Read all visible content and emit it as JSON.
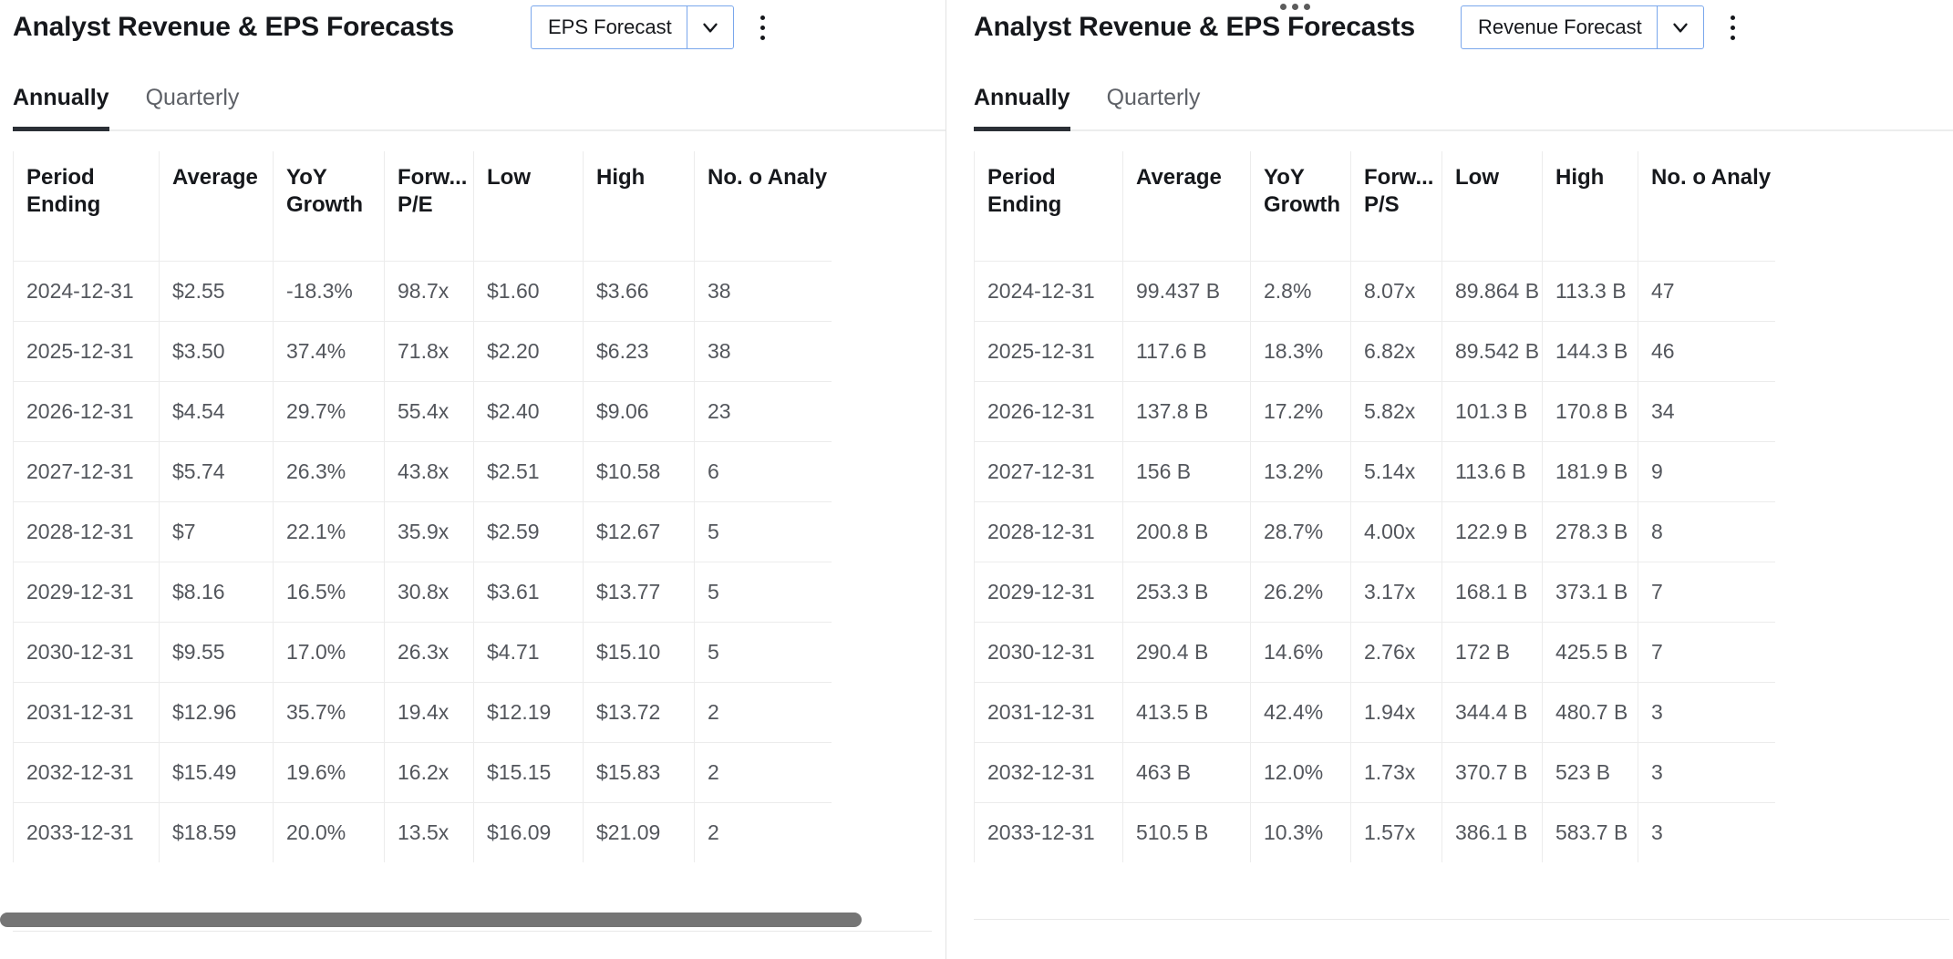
{
  "panels": [
    {
      "id": "eps-panel",
      "title": "Analyst Revenue & EPS Forecasts",
      "select": {
        "value": "EPS Forecast",
        "caret_icon": "chevron-down-icon",
        "border_color": "#7aa7ec"
      },
      "kebab_icon": "kebab-menu-icon",
      "tabs": [
        {
          "label": "Annually",
          "active": true
        },
        {
          "label": "Quarterly",
          "active": false
        }
      ],
      "table": {
        "columns": [
          "Period Ending",
          "Average",
          "YoY Growth",
          "Forw... P/E",
          "Low",
          "High",
          "No. o Analy"
        ],
        "rows": [
          [
            "2024-12-31",
            "$2.55",
            "-18.3%",
            "98.7x",
            "$1.60",
            "$3.66",
            "38"
          ],
          [
            "2025-12-31",
            "$3.50",
            "37.4%",
            "71.8x",
            "$2.20",
            "$6.23",
            "38"
          ],
          [
            "2026-12-31",
            "$4.54",
            "29.7%",
            "55.4x",
            "$2.40",
            "$9.06",
            "23"
          ],
          [
            "2027-12-31",
            "$5.74",
            "26.3%",
            "43.8x",
            "$2.51",
            "$10.58",
            "6"
          ],
          [
            "2028-12-31",
            "$7",
            "22.1%",
            "35.9x",
            "$2.59",
            "$12.67",
            "5"
          ],
          [
            "2029-12-31",
            "$8.16",
            "16.5%",
            "30.8x",
            "$3.61",
            "$13.77",
            "5"
          ],
          [
            "2030-12-31",
            "$9.55",
            "17.0%",
            "26.3x",
            "$4.71",
            "$15.10",
            "5"
          ],
          [
            "2031-12-31",
            "$12.96",
            "35.7%",
            "19.4x",
            "$12.19",
            "$13.72",
            "2"
          ],
          [
            "2032-12-31",
            "$15.49",
            "19.6%",
            "16.2x",
            "$15.15",
            "$15.83",
            "2"
          ],
          [
            "2033-12-31",
            "$18.59",
            "20.0%",
            "13.5x",
            "$16.09",
            "$21.09",
            "2"
          ]
        ]
      },
      "scrollbar": {
        "visible": true,
        "orientation": "horizontal"
      }
    },
    {
      "id": "revenue-panel",
      "title": "Analyst Revenue & EPS Forecasts",
      "drag_handle_icon": "ellipsis-horizontal-icon",
      "select": {
        "value": "Revenue Forecast",
        "caret_icon": "chevron-down-icon",
        "border_color": "#7aa7ec"
      },
      "kebab_icon": "kebab-menu-icon",
      "tabs": [
        {
          "label": "Annually",
          "active": true
        },
        {
          "label": "Quarterly",
          "active": false
        }
      ],
      "table": {
        "columns": [
          "Period Ending",
          "Average",
          "YoY Growth",
          "Forw... P/S",
          "Low",
          "High",
          "No. o Analy"
        ],
        "rows": [
          [
            "2024-12-31",
            "99.437 B",
            "2.8%",
            "8.07x",
            "89.864 B",
            "113.3 B",
            "47"
          ],
          [
            "2025-12-31",
            "117.6 B",
            "18.3%",
            "6.82x",
            "89.542 B",
            "144.3 B",
            "46"
          ],
          [
            "2026-12-31",
            "137.8 B",
            "17.2%",
            "5.82x",
            "101.3 B",
            "170.8 B",
            "34"
          ],
          [
            "2027-12-31",
            "156 B",
            "13.2%",
            "5.14x",
            "113.6 B",
            "181.9 B",
            "9"
          ],
          [
            "2028-12-31",
            "200.8 B",
            "28.7%",
            "4.00x",
            "122.9 B",
            "278.3 B",
            "8"
          ],
          [
            "2029-12-31",
            "253.3 B",
            "26.2%",
            "3.17x",
            "168.1 B",
            "373.1 B",
            "7"
          ],
          [
            "2030-12-31",
            "290.4 B",
            "14.6%",
            "2.76x",
            "172 B",
            "425.5 B",
            "7"
          ],
          [
            "2031-12-31",
            "413.5 B",
            "42.4%",
            "1.94x",
            "344.4 B",
            "480.7 B",
            "3"
          ],
          [
            "2032-12-31",
            "463 B",
            "12.0%",
            "1.73x",
            "370.7 B",
            "523 B",
            "3"
          ],
          [
            "2033-12-31",
            "510.5 B",
            "10.3%",
            "1.57x",
            "386.1 B",
            "583.7 B",
            "3"
          ]
        ]
      },
      "scrollbar": {
        "visible": false,
        "orientation": "horizontal"
      }
    }
  ]
}
